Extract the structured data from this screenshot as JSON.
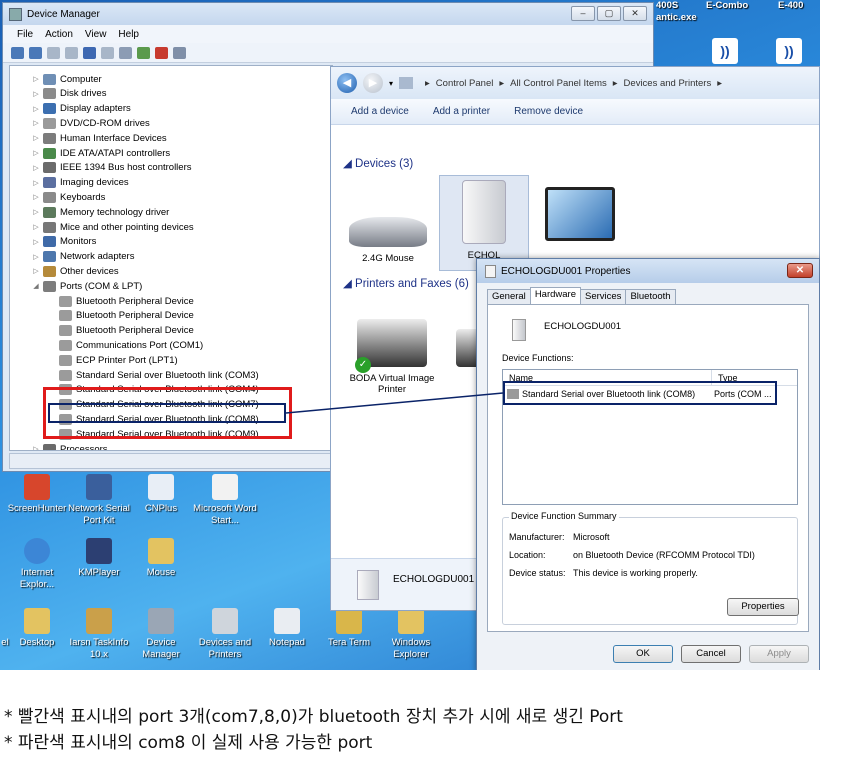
{
  "desktop": {
    "top_items": [
      "400S",
      "antic.exe",
      "E-Combo",
      "E-400"
    ],
    "icons_row1": [
      "ScreenHunter",
      "Network Serial Port Kit",
      "CNPlus",
      "Microsoft Word Start..."
    ],
    "icons_row2": [
      "Internet Explor...",
      "KMPlayer",
      "Mouse"
    ],
    "icons_row3": [
      "el",
      "Desktop",
      "Iarsn TaskInfo 10.x",
      "Device Manager",
      "Devices and Printers",
      "Notepad",
      "Tera Term",
      "Windows Explorer"
    ]
  },
  "device_manager": {
    "title": "Device Manager",
    "menu": [
      "File",
      "Action",
      "View",
      "Help"
    ],
    "tree": [
      {
        "label": "Computer",
        "arrow": "▷",
        "indent": 0,
        "icon": "#6f8fb5"
      },
      {
        "label": "Disk drives",
        "arrow": "▷",
        "indent": 0,
        "icon": "#8b8b8b"
      },
      {
        "label": "Display adapters",
        "arrow": "▷",
        "indent": 0,
        "icon": "#3c6fb0"
      },
      {
        "label": "DVD/CD-ROM drives",
        "arrow": "▷",
        "indent": 0,
        "icon": "#9a9a9a"
      },
      {
        "label": "Human Interface Devices",
        "arrow": "▷",
        "indent": 0,
        "icon": "#7c7c7c"
      },
      {
        "label": "IDE ATA/ATAPI controllers",
        "arrow": "▷",
        "indent": 0,
        "icon": "#4a8a4a"
      },
      {
        "label": "IEEE 1394 Bus host controllers",
        "arrow": "▷",
        "indent": 0,
        "icon": "#6b6b6b"
      },
      {
        "label": "Imaging devices",
        "arrow": "▷",
        "indent": 0,
        "icon": "#5b6fa0"
      },
      {
        "label": "Keyboards",
        "arrow": "▷",
        "indent": 0,
        "icon": "#8a8a8a"
      },
      {
        "label": "Memory technology driver",
        "arrow": "▷",
        "indent": 0,
        "icon": "#5c7a5c"
      },
      {
        "label": "Mice and other pointing devices",
        "arrow": "▷",
        "indent": 0,
        "icon": "#777777"
      },
      {
        "label": "Monitors",
        "arrow": "▷",
        "indent": 0,
        "icon": "#3f6aa8"
      },
      {
        "label": "Network adapters",
        "arrow": "▷",
        "indent": 0,
        "icon": "#4d77ad"
      },
      {
        "label": "Other devices",
        "arrow": "▷",
        "indent": 0,
        "icon": "#b58a3a"
      },
      {
        "label": "Ports (COM & LPT)",
        "arrow": "◢",
        "indent": 0,
        "icon": "#7d7d7d"
      },
      {
        "label": "Bluetooth Peripheral Device",
        "arrow": "",
        "indent": 1,
        "icon": "#9b9b9b"
      },
      {
        "label": "Bluetooth Peripheral Device",
        "arrow": "",
        "indent": 1,
        "icon": "#9b9b9b"
      },
      {
        "label": "Bluetooth Peripheral Device",
        "arrow": "",
        "indent": 1,
        "icon": "#9b9b9b"
      },
      {
        "label": "Communications Port (COM1)",
        "arrow": "",
        "indent": 1,
        "icon": "#9b9b9b"
      },
      {
        "label": "ECP Printer Port (LPT1)",
        "arrow": "",
        "indent": 1,
        "icon": "#9b9b9b"
      },
      {
        "label": "Standard Serial over Bluetooth link (COM3)",
        "arrow": "",
        "indent": 1,
        "icon": "#9b9b9b"
      },
      {
        "label": "Standard Serial over Bluetooth link (COM4)",
        "arrow": "",
        "indent": 1,
        "icon": "#9b9b9b"
      },
      {
        "label": "Standard Serial over Bluetooth link (COM7)",
        "arrow": "",
        "indent": 1,
        "icon": "#9b9b9b"
      },
      {
        "label": "Standard Serial over Bluetooth link (COM8)",
        "arrow": "",
        "indent": 1,
        "icon": "#9b9b9b"
      },
      {
        "label": "Standard Serial over Bluetooth link (COM9)",
        "arrow": "",
        "indent": 1,
        "icon": "#9b9b9b"
      },
      {
        "label": "Processors",
        "arrow": "▷",
        "indent": 0,
        "icon": "#6a6a6a"
      }
    ]
  },
  "control_panel": {
    "breadcrumbs": [
      "Control Panel",
      "All Control Panel Items",
      "Devices and Printers"
    ],
    "commands": [
      "Add a device",
      "Add a printer",
      "Remove device"
    ],
    "devices_header": "Devices (3)",
    "devices": [
      "2.4G Mouse",
      "ECHOL",
      ""
    ],
    "printers_header": "Printers and Faxes (6)",
    "printer_label": "BODA Virtual Image Printer",
    "bottom_name": "ECHOLOGDU001"
  },
  "dialog": {
    "title": "ECHOLOGDU001 Properties",
    "close": "✕",
    "tabs": [
      "General",
      "Hardware",
      "Services",
      "Bluetooth"
    ],
    "device_name": "ECHOLOGDU001",
    "functions_label": "Device Functions:",
    "col_name": "Name",
    "col_type": "Type",
    "row_name": "Standard Serial over Bluetooth link (COM8)",
    "row_type": "Ports (COM ...",
    "summary_title": "Device Function Summary",
    "manufacturer_k": "Manufacturer:",
    "manufacturer_v": "Microsoft",
    "location_k": "Location:",
    "location_v": "on Bluetooth Device (RFCOMM Protocol TDI)",
    "status_k": "Device status:",
    "status_v": "This device is working properly.",
    "properties_btn": "Properties",
    "ok": "OK",
    "cancel": "Cancel",
    "apply": "Apply"
  },
  "notes": {
    "line1": "* 빨간색 표시내의 port 3개(com7,8,0)가 bluetooth 장치 추가 시에 새로 생긴 Port",
    "line2": "* 파란색 표시내의 com8 이 실제 사용 가능한 port"
  }
}
